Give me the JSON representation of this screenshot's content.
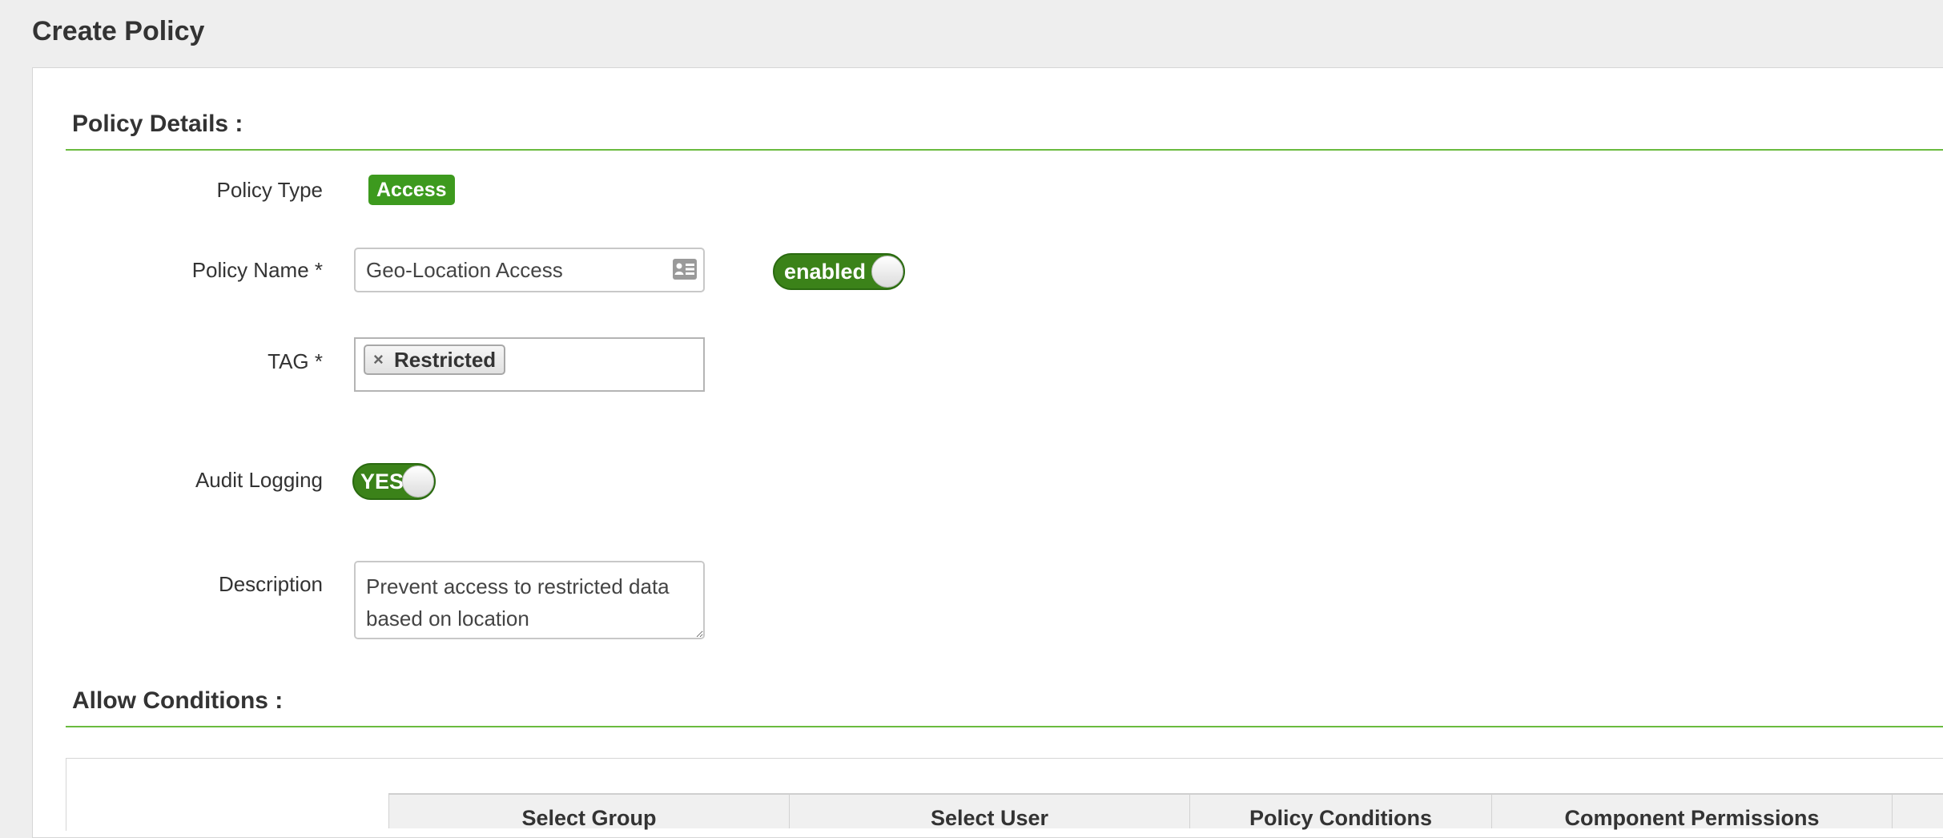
{
  "page": {
    "title": "Create Policy"
  },
  "policy_details": {
    "section_title": "Policy Details :",
    "policy_type": {
      "label": "Policy Type",
      "value": "Access"
    },
    "policy_name": {
      "label": "Policy Name *",
      "value": "Geo-Location Access",
      "addon_icon": "contact-card-icon",
      "toggle_label": "enabled"
    },
    "tag": {
      "label": "TAG *",
      "chips": [
        "Restricted"
      ],
      "remove_symbol": "×"
    },
    "audit_logging": {
      "label": "Audit Logging",
      "toggle_label": "YES"
    },
    "description": {
      "label": "Description",
      "value": "Prevent access to restricted data based on location"
    }
  },
  "allow_conditions": {
    "section_title": "Allow Conditions :",
    "columns": [
      "Select Group",
      "Select User",
      "Policy Conditions",
      "Component Permissions"
    ]
  },
  "colors": {
    "accent_green": "#3d9a1e",
    "toggle_green": "#3b8219",
    "section_rule": "#6abb3f",
    "background": "#eeeeee"
  }
}
